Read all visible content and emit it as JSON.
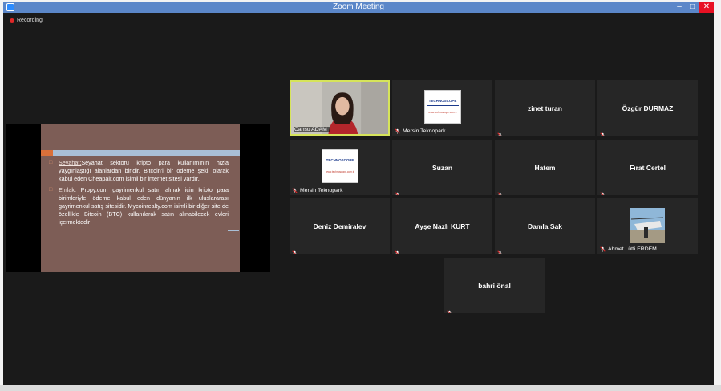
{
  "window": {
    "title": "Zoom Meeting",
    "minimize": "–",
    "maximize": "□",
    "close": "✕"
  },
  "status": {
    "recording_label": "Recording"
  },
  "shared_slide": {
    "bullets": [
      {
        "term": "Seyahat:",
        "text": "Seyahat sektörü kripto para kullanımının hızla yaygınlaştığı alanlardan biridir. Bitcoin'i bir ödeme şekli olarak kabul eden Cheapair.com isimli bir internet sitesi vardır."
      },
      {
        "term": "Emlak:",
        "text": " Propy.com gayrimenkul satın almak için kripto para birimleriyle ödeme kabul eden dünyanın ilk uluslararası gayrimenkul satış sitesidir. Mycoinrealty.com isimli bir diğer site de özellikle Bitcoin (BTC) kullanılarak satın alınabilecek evleri içermektedir"
      }
    ]
  },
  "participants": [
    {
      "name": "Cansu ADAM",
      "kind": "video-person",
      "active": true
    },
    {
      "name": "Mersin Teknopark",
      "kind": "logo"
    },
    {
      "name": "zinet turan",
      "kind": "name"
    },
    {
      "name": "Özgür DURMAZ",
      "kind": "name"
    },
    {
      "name": "Mersin Teknopark",
      "kind": "logo"
    },
    {
      "name": "Suzan",
      "kind": "name"
    },
    {
      "name": "Hatem",
      "kind": "name"
    },
    {
      "name": "Fırat Certel",
      "kind": "name"
    },
    {
      "name": "Deniz Demiralev",
      "kind": "name"
    },
    {
      "name": "Ayşe Nazlı KURT",
      "kind": "name"
    },
    {
      "name": "Damla Sak",
      "kind": "name"
    },
    {
      "name": "Ahmet Lütfi ERDEM",
      "kind": "photo"
    },
    {
      "name": "bahri önal",
      "kind": "name"
    }
  ],
  "logo": {
    "brand": "TECHNOSCOPE",
    "sub": "www.technoscope.com.tr"
  },
  "colors": {
    "active_border": "#d6e45a",
    "muted_mic": "#e02828",
    "tile_bg": "#262626"
  }
}
